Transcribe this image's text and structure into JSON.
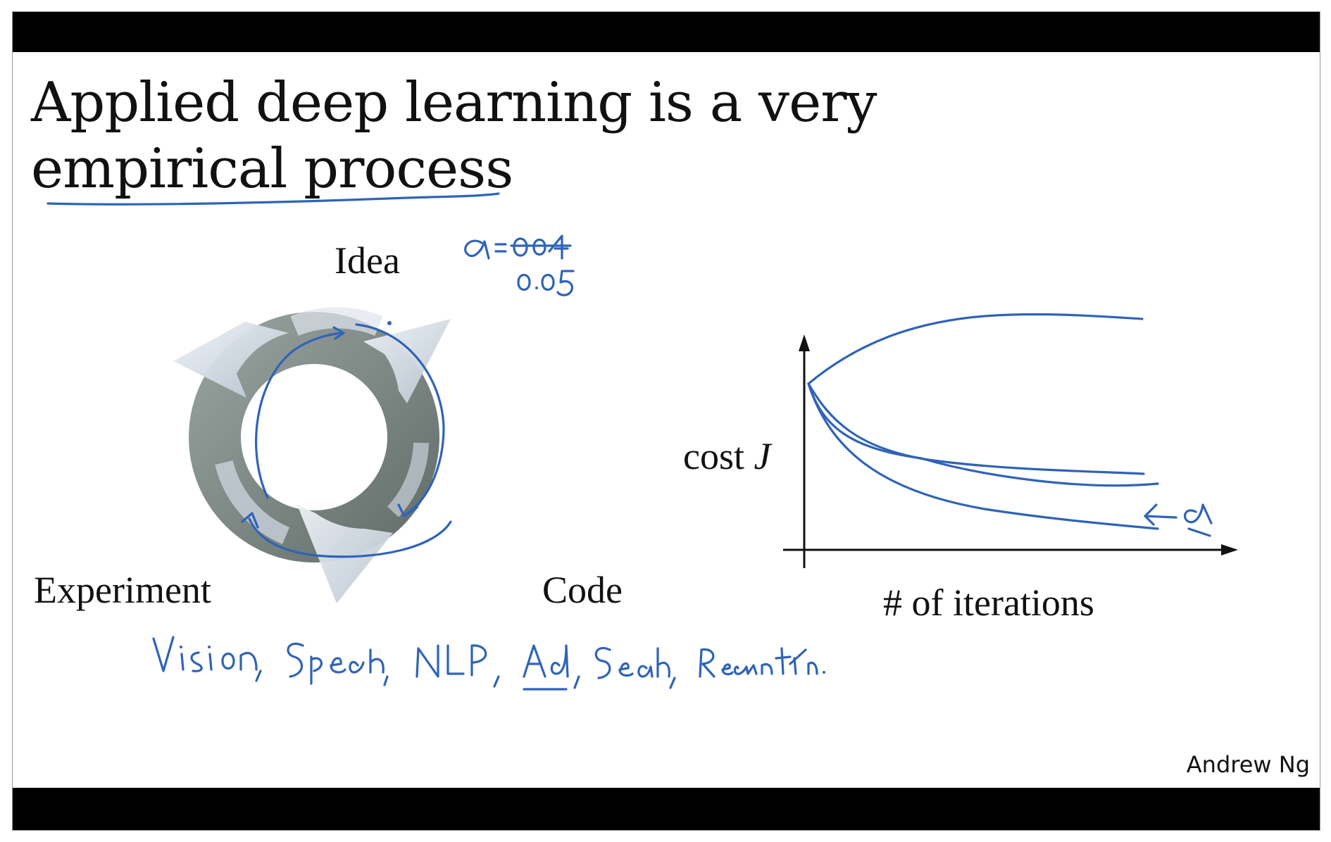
{
  "slide": {
    "title_line1": "Applied deep learning is a very",
    "title_line2": "empirical process",
    "cycle": {
      "idea": "Idea",
      "experiment": "Experiment",
      "code": "Code"
    },
    "plot": {
      "ylabel_prefix": "cost ",
      "ylabel_var": "J",
      "xlabel": "# of iterations"
    },
    "author": "Andrew Ng"
  },
  "colors": {
    "ink": "#2f63b7",
    "bars": "#000000",
    "ring_dark": "#7f8a86",
    "ring_light": "#dfe6ee"
  },
  "icons": {
    "cycle_diagram": "circular-arrows-icon"
  }
}
